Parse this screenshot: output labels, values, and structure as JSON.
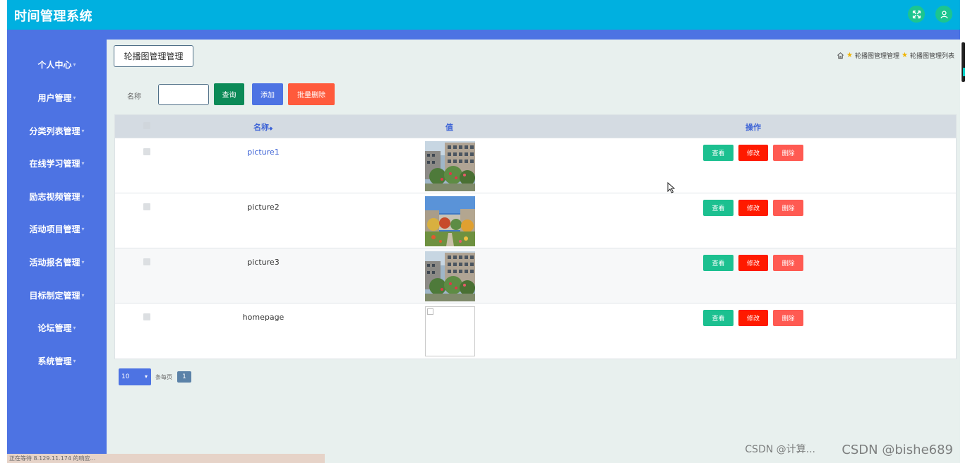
{
  "app": {
    "title": "时间管理系统"
  },
  "sidebar": {
    "items": [
      {
        "label": "个人中心"
      },
      {
        "label": "用户管理"
      },
      {
        "label": "分类列表管理"
      },
      {
        "label": "在线学习管理"
      },
      {
        "label": "励志视频管理"
      },
      {
        "label": "活动项目管理"
      },
      {
        "label": "活动报名管理"
      },
      {
        "label": "目标制定管理"
      },
      {
        "label": "论坛管理"
      },
      {
        "label": "系统管理"
      }
    ]
  },
  "page": {
    "title": "轮播图管理管理",
    "breadcrumb": [
      "轮播图管理管理",
      "轮播图管理列表"
    ]
  },
  "search": {
    "label": "名称",
    "value": "",
    "query_label": "查询",
    "add_label": "添加",
    "batch_delete_label": "批量删除"
  },
  "table": {
    "headers": {
      "name": "名称",
      "value": "值",
      "actions": "操作"
    },
    "sort_indicator": "◆",
    "rows": [
      {
        "name": "picture1",
        "image": "building"
      },
      {
        "name": "picture2",
        "image": "garden"
      },
      {
        "name": "picture3",
        "image": "building"
      },
      {
        "name": "homepage",
        "image": "broken"
      }
    ],
    "actions": {
      "view": "查看",
      "edit": "修改",
      "delete": "删除"
    }
  },
  "pagination": {
    "page_size": "10",
    "per_page_text": "条每页",
    "current_page": "1"
  },
  "statusbar": {
    "text": "正在等待 8.129.11.174 的响应..."
  },
  "watermark": {
    "text": "CSDN @bishe689",
    "text2": "CSDN @计算..."
  },
  "colors": {
    "topbar": "#00b0e0",
    "sidebar": "#4d73e3",
    "query_button": "#0b8a57",
    "view_button": "#1cc090",
    "edit_button": "#ff1a00",
    "delete_button": "#ff5a52",
    "batch_delete_button": "#ff5a3c"
  }
}
